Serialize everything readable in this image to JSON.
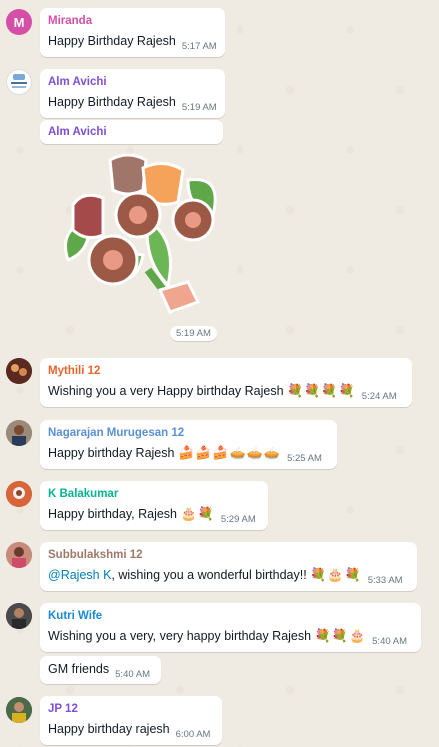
{
  "colors": {
    "chat_bg": "#efeae2",
    "bubble_bg": "#ffffff",
    "miranda": "#d64fa6",
    "alm": "#7d4fd6",
    "mythili": "#e8642c",
    "nagarajan": "#5a8fd6",
    "balakumar": "#06b48f",
    "subbulakshmi": "#a0786a",
    "kutri": "#1a8ad6",
    "jp": "#7d4fd6",
    "mention": "#027eb5"
  },
  "messages": [
    {
      "avatar_letter": "M",
      "sender": "Miranda",
      "text": "Happy Birthday Rajesh",
      "time": "5:17 AM"
    },
    {
      "sender": "Alm Avichi",
      "text": "Happy Birthday Rajesh",
      "time": "5:19 AM"
    },
    {
      "sender": "Alm Avichi",
      "sticker": "flower-bouquet-sticker",
      "time": "5:19 AM"
    },
    {
      "sender": "Mythili 12",
      "text": "Wishing you a very Happy birthday Rajesh",
      "emojis": "💐💐💐💐",
      "time": "5:24 AM"
    },
    {
      "sender": "Nagarajan Murugesan 12",
      "text": "Happy birthday Rajesh",
      "emojis": "🍰🍰🍰🥧🥧🥧",
      "time": "5:25 AM"
    },
    {
      "sender": "K Balakumar",
      "text": "Happy birthday, Rajesh",
      "emojis": "🎂💐",
      "time": "5:29 AM"
    },
    {
      "sender": "Subbulakshmi 12",
      "mention": "@Rajesh K",
      "text": ", wishing you a wonderful birthday!!",
      "emojis": "💐🎂💐",
      "time": "5:33 AM"
    },
    {
      "sender": "Kutri Wife",
      "text": "Wishing you a very, very happy birthday Rajesh",
      "emojis": "💐💐🎂",
      "time": "5:40 AM"
    },
    {
      "text": "GM friends",
      "time": "5:40 AM"
    },
    {
      "sender": "JP 12",
      "text": "Happy birthday rajesh",
      "time": "6:00 AM"
    }
  ]
}
